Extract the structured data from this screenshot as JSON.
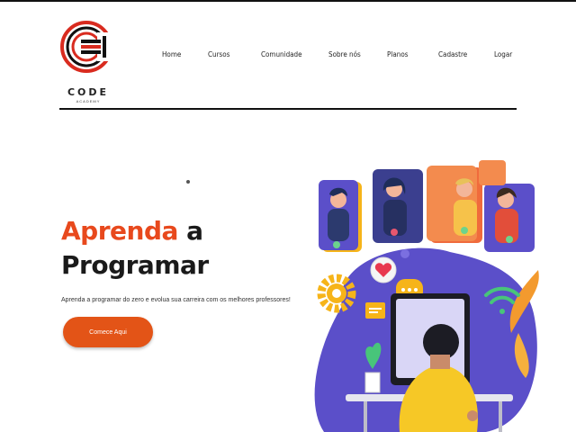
{
  "brand": {
    "name": "CODE",
    "tagline": "ACADEMY",
    "colors": {
      "accent": "#e8491d",
      "button": "#e35417",
      "logo_red": "#d92b1f"
    }
  },
  "nav": {
    "items": [
      {
        "label": "Home"
      },
      {
        "label": "Cursos"
      },
      {
        "label": "Comunidade"
      },
      {
        "label": "Sobre nós"
      },
      {
        "label": "Planos"
      },
      {
        "label": "Cadastre"
      },
      {
        "label": "Logar"
      }
    ]
  },
  "hero": {
    "title_accent": "Aprenda",
    "title_rest_1": "a",
    "title_rest_2": "Programar",
    "subtitle": "Aprenda a programar do zero e evolua sua carreira com os melhores professores!",
    "cta_label": "Comece Aqui"
  },
  "illustration": {
    "icons": [
      "video-call-icon",
      "heart-icon",
      "chat-bubble-icon",
      "gear-icon",
      "wifi-icon",
      "plant-icon"
    ]
  }
}
